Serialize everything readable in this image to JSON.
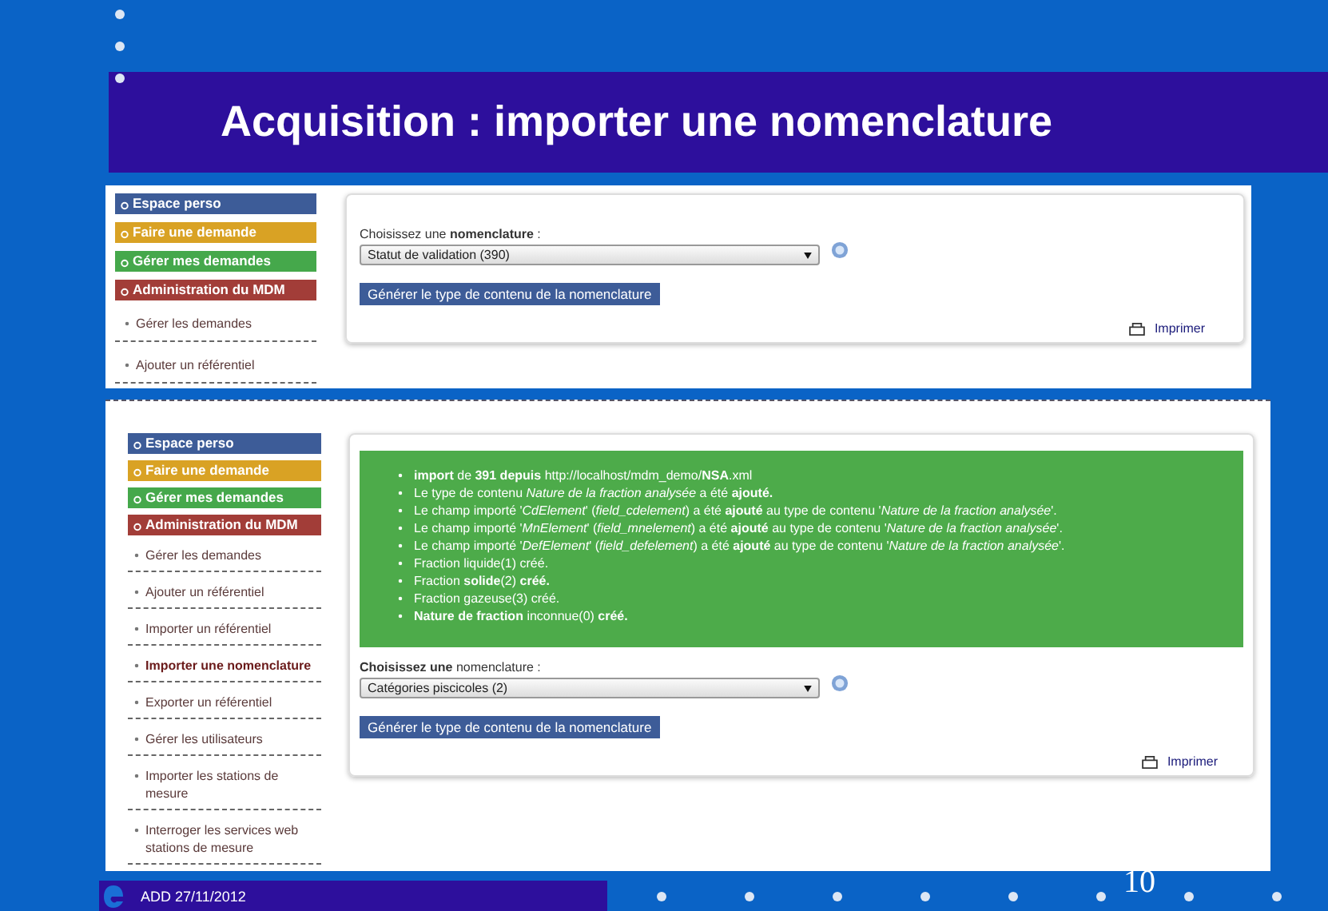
{
  "slide": {
    "title": "Acquisition : importer une nomenclature",
    "footer": "ADD 27/11/2012",
    "page_number": "10"
  },
  "screenshots": [
    {
      "menu": [
        {
          "label": "Espace perso",
          "color": "#3d5c98"
        },
        {
          "label": "Faire une demande",
          "color": "#d9a224"
        },
        {
          "label": "Gérer mes demandes",
          "color": "#45a84b"
        },
        {
          "label": "Administration du MDM",
          "color": "#a23d38"
        }
      ],
      "submenu": [
        {
          "label": "Gérer les demandes",
          "selected": false
        },
        {
          "label": "Ajouter un référentiel",
          "selected": false
        }
      ],
      "form": {
        "label": "Choisissez une **nomenclature** :",
        "select_value": "Statut de validation (390)",
        "button": "Générer le type de contenu de la nomenclature"
      },
      "print_link": "Imprimer"
    },
    {
      "menu": [
        {
          "label": "Espace perso",
          "color": "#3d5c98"
        },
        {
          "label": "Faire une demande",
          "color": "#d9a224"
        },
        {
          "label": "Gérer mes demandes",
          "color": "#45a84b"
        },
        {
          "label": "Administration du MDM",
          "color": "#a23d38"
        }
      ],
      "submenu": [
        {
          "label": "Gérer les demandes",
          "selected": false
        },
        {
          "label": "Ajouter un référentiel",
          "selected": false
        },
        {
          "label": "Importer un référentiel",
          "selected": false
        },
        {
          "label": "Importer une nomenclature",
          "selected": true
        },
        {
          "label": "Exporter un référentiel",
          "selected": false
        },
        {
          "label": "Gérer les utilisateurs",
          "selected": false
        },
        {
          "label": "Importer les stations de mesure",
          "selected": false
        },
        {
          "label": "Interroger les services web stations de mesure",
          "selected": false
        }
      ],
      "messages": [
        "**import** de **391 depuis** http://localhost/mdm_demo/**NSA**.xml",
        "Le type de contenu *Nature de la fraction analysée* a été **ajouté.**",
        "Le champ importé '*CdElement*' (*field_cdelement*) a été **ajouté** au type de contenu '*Nature de la fraction analysée*'.",
        "Le champ importé '*MnElement*' (*field_mnelement*) a été **ajouté** au type de contenu '*Nature de la fraction analysée*'.",
        "Le champ importé '*DefElement*' (*field_defelement*) a été **ajouté** au type de contenu '*Nature de la fraction analysée*'.",
        "Fraction liquide(1) créé.",
        "Fraction **solide**(2) **créé.**",
        "Fraction gazeuse(3) créé.",
        "**Nature de fraction** inconnue(0) **créé.**"
      ],
      "form": {
        "label": "**Choisissez une** nomenclature :",
        "select_value": "Catégories piscicoles (2)",
        "button": "Générer le type de contenu de la nomenclature"
      },
      "print_link": "Imprimer"
    }
  ]
}
